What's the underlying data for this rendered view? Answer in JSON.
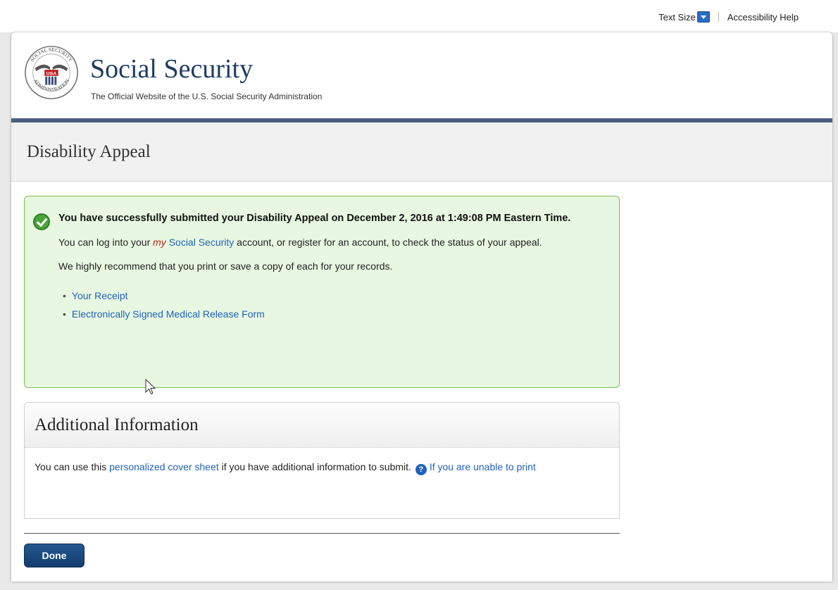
{
  "utility": {
    "text_size_label": "Text Size",
    "accessibility_label": "Accessibility Help"
  },
  "header": {
    "title": "Social Security",
    "subtitle": "The Official Website of the U.S. Social Security Administration",
    "logo_text_top": "SOCIAL SECURITY",
    "logo_text_bottom": "ADMINISTRATION",
    "logo_usa": "USA"
  },
  "page": {
    "title": "Disability Appeal"
  },
  "success": {
    "message": "You have successfully submitted your Disability Appeal on December 2, 2016 at 1:49:08 PM Eastern Time.",
    "login_pre": "You can log into your ",
    "login_my": "my",
    "login_link": " Social Security",
    "login_post": " account, or register for an account, to check the status of your appeal.",
    "recommend": "We highly recommend that you print or save a copy of each for your records.",
    "documents": [
      "Your Receipt",
      "Electronically Signed Medical Release Form"
    ]
  },
  "additional": {
    "title": "Additional Information",
    "pre": "You can use this ",
    "link": "personalized cover sheet",
    "post": " if you have additional information to submit. ",
    "help_icon": "?",
    "unable_link": "If you are unable to print"
  },
  "actions": {
    "done_label": "Done"
  },
  "colors": {
    "accent_link": "#1f63b9",
    "success_bg": "#e8f7e1",
    "success_border": "#7cbf57",
    "header_rule": "#4a5e80",
    "button": "#123d6e"
  }
}
